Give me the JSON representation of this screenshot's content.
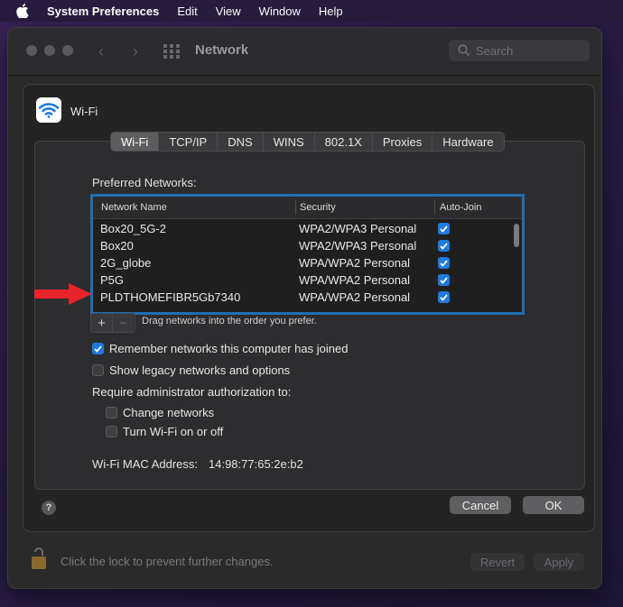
{
  "menubar": {
    "app": "System Preferences",
    "items": [
      "Edit",
      "View",
      "Window",
      "Help"
    ]
  },
  "window": {
    "title": "Network",
    "search_placeholder": "Search"
  },
  "sheet": {
    "header_label": "Wi-Fi",
    "tabs": [
      {
        "label": "Wi-Fi",
        "active": true
      },
      {
        "label": "TCP/IP"
      },
      {
        "label": "DNS"
      },
      {
        "label": "WINS"
      },
      {
        "label": "802.1X"
      },
      {
        "label": "Proxies"
      },
      {
        "label": "Hardware"
      }
    ],
    "preferred_label": "Preferred Networks:",
    "columns": [
      "Network Name",
      "Security",
      "Auto-Join"
    ],
    "networks": [
      {
        "name": "Box20_5G-2",
        "security": "WPA2/WPA3 Personal",
        "auto_join": true
      },
      {
        "name": "Box20",
        "security": "WPA2/WPA3 Personal",
        "auto_join": true
      },
      {
        "name": "2G_globe",
        "security": "WPA/WPA2 Personal",
        "auto_join": true
      },
      {
        "name": "P5G",
        "security": "WPA/WPA2 Personal",
        "auto_join": true
      },
      {
        "name": "PLDTHOMEFIBR5Gb7340",
        "security": "WPA/WPA2 Personal",
        "auto_join": true
      }
    ],
    "add_label": "+",
    "remove_label": "−",
    "drag_hint": "Drag networks into the order you prefer.",
    "remember_label": "Remember networks this computer has joined",
    "remember_checked": true,
    "legacy_label": "Show legacy networks and options",
    "legacy_checked": false,
    "require_label": "Require administrator authorization to:",
    "change_networks_label": "Change networks",
    "change_networks_checked": false,
    "turn_wifi_label": "Turn Wi-Fi on or off",
    "turn_wifi_checked": false,
    "mac_label": "Wi-Fi MAC Address:",
    "mac_value": "14:98:77:65:2e:b2",
    "help_label": "?",
    "cancel_label": "Cancel",
    "ok_label": "OK"
  },
  "footer": {
    "lock_text": "Click the lock to prevent further changes.",
    "revert_label": "Revert",
    "apply_label": "Apply"
  },
  "colors": {
    "accent": "#1f7ae0",
    "selection_border": "#1d6fb6",
    "annotation_arrow": "#e8232a"
  }
}
